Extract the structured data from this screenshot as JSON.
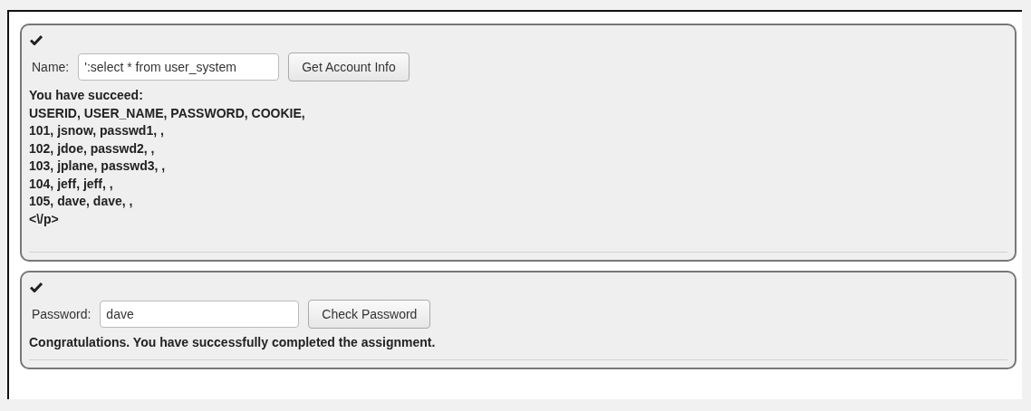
{
  "sections": [
    {
      "completed": true,
      "field_label": "Name:",
      "field_value": "':select * from user_system",
      "button": "Get Account Info",
      "output": [
        "You have succeed:",
        "USERID, USER_NAME, PASSWORD, COOKIE,",
        "101, jsnow, passwd1, ,",
        "102, jdoe, passwd2, ,",
        "103, jplane, passwd3, ,",
        "104, jeff, jeff, ,",
        "105, dave, dave, ,",
        "<\\/p>"
      ]
    },
    {
      "completed": true,
      "field_label": "Password:",
      "field_value": "dave",
      "button": "Check Password",
      "output": [
        "Congratulations. You have successfully completed the assignment."
      ]
    }
  ]
}
